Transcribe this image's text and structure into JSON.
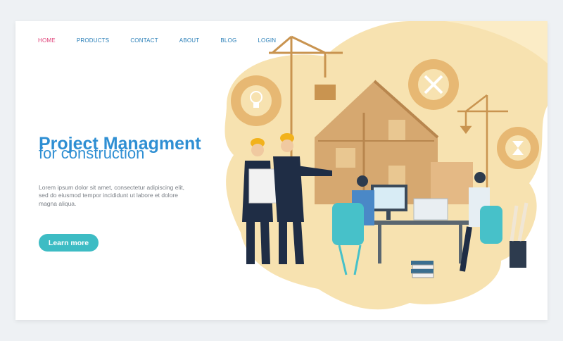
{
  "nav": {
    "items": [
      {
        "label": "HOME",
        "active": true
      },
      {
        "label": "PRODUCTS",
        "active": false
      },
      {
        "label": "CONTACT",
        "active": false
      },
      {
        "label": "ABOUT",
        "active": false
      },
      {
        "label": "BLOG",
        "active": false
      },
      {
        "label": "LOGIN",
        "active": false
      }
    ]
  },
  "hero": {
    "title": "Project Managment",
    "subtitle": "for construction",
    "description": "Lorem ipsum dolor sit amet, consectetur adipiscing elit, sed do eiusmod tempor incididunt ut labore et dolore magna aliqua.",
    "cta_label": "Learn more"
  },
  "colors": {
    "accent": "#3dbcc4",
    "title": "#2f8fd3",
    "nav_active": "#e0457b",
    "nav": "#2a7fb8",
    "blob": "#f7e2b0",
    "house": "#d6a870"
  }
}
